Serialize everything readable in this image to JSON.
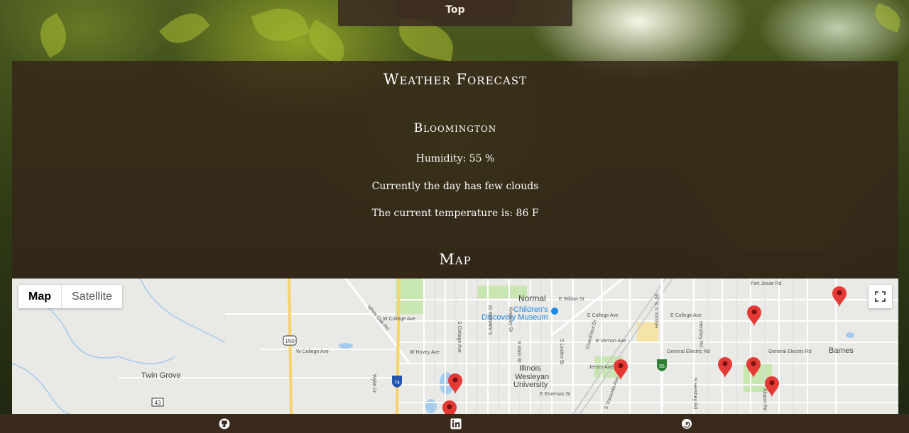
{
  "nav": {
    "top_label": "Top"
  },
  "weather": {
    "title": "Weather Forecast",
    "city": "Bloomington",
    "humidity": "Humidity: 55 %",
    "conditions": "Currently the day has few clouds",
    "temperature": "The current temperature is: 86 F"
  },
  "map": {
    "title": "Map",
    "type_control": {
      "map_label": "Map",
      "satellite_label": "Satellite",
      "selected": "Map"
    },
    "place_labels": {
      "normal": "Normal",
      "childrens_museum_1": "Children's",
      "childrens_museum_2": "Discovery Museum",
      "twin_grove": "Twin Grove",
      "illinois_wesleyan_1": "Illinois",
      "illinois_wesleyan_2": "Wesleyan",
      "illinois_wesleyan_3": "University",
      "barnes": "Barnes"
    },
    "street_labels": {
      "w_college_ave_1": "W College Ave",
      "w_college_ave_2": "W College Ave",
      "w_hovey_ave": "W Hovey Ave",
      "e_college_ave_1": "E College Ave",
      "e_college_ave_2": "E College Ave",
      "e_willow_st": "E Willow St",
      "fort_jesse_rd": "Fort Jesse Rd",
      "general_electric_rd_1": "General Electric Rd",
      "general_electric_rd_2": "General Electric Rd",
      "jersey_ave": "Jersey Ave",
      "e_emerson_st": "E Emerson St",
      "e_vernon_ave": "E Vernon Ave",
      "white_oak_rd": "White Oak Rd",
      "s_cottage_ave": "S Cottage Ave",
      "s_adelaide_st": "S Adelaide St",
      "kingsley_st": "Kingsley St",
      "s_main_st": "S Main St",
      "s_linden_st": "S Linden St",
      "grandview_dr": "Grandview Dr",
      "historic_us_66": "Historic U.S. 66",
      "s_towanda_ave": "S Towanda Ave",
      "airport_rd": "Airport Rd",
      "n_hershey_rd": "N Hershey Rd",
      "hershey_rd": "Hershey Rd",
      "wylie_dr": "Wylie Dr"
    },
    "shields": {
      "us_150": "150",
      "i_74": "74",
      "i_55": "55",
      "route_43": "43"
    }
  },
  "colors": {
    "panel": "#34261a",
    "footer": "#3a2a1c",
    "marker": "#e53935",
    "park": "#c8e6b0",
    "water": "#a4cbf0",
    "highway": "#f7d36b"
  },
  "footer": {
    "icons": [
      "github-icon",
      "linkedin-icon",
      "spiral-icon"
    ]
  }
}
